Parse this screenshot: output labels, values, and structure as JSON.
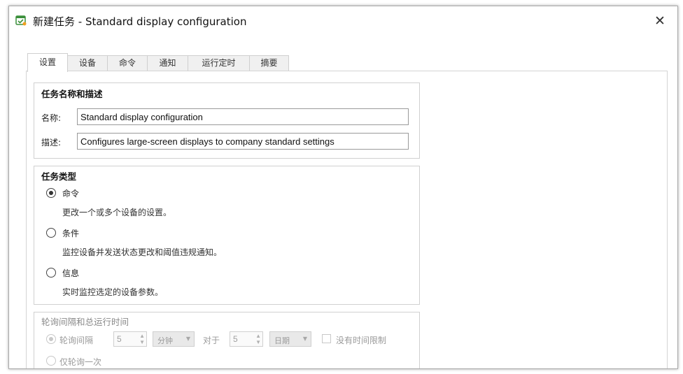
{
  "window": {
    "title": "新建任务 - Standard display configuration",
    "close_glyph": "✕",
    "icon": "task-app-icon"
  },
  "tabs": [
    {
      "label": "设置",
      "active": true
    },
    {
      "label": "设备",
      "active": false
    },
    {
      "label": "命令",
      "active": false
    },
    {
      "label": "通知",
      "active": false
    },
    {
      "label": "运行定时",
      "active": false
    },
    {
      "label": "摘要",
      "active": false
    }
  ],
  "name_group": {
    "title": "任务名称和描述",
    "name_label": "名称:",
    "name_value": "Standard display configuration",
    "desc_label": "描述:",
    "desc_value": "Configures large-screen displays to company standard settings"
  },
  "type_group": {
    "title": "任务类型",
    "options": [
      {
        "label": "命令",
        "desc": "更改一个或多个设备的设置。",
        "checked": true
      },
      {
        "label": "条件",
        "desc": "监控设备并发送状态更改和阈值违规通知。",
        "checked": false
      },
      {
        "label": "信息",
        "desc": "实时监控选定的设备参数。",
        "checked": false
      }
    ]
  },
  "polling_group": {
    "title": "轮询间隔和总运行时间",
    "interval_label": "轮询间隔",
    "interval_value": "5",
    "interval_unit": "分钟",
    "for_label": "对于",
    "duration_value": "5",
    "duration_unit": "日期",
    "no_limit_label": "没有时间限制",
    "poll_once_label": "仅轮询一次"
  },
  "colors": {
    "border": "#d0d0d0",
    "disabled_text": "#9a9a9a",
    "window_bg": "#ffffff"
  }
}
